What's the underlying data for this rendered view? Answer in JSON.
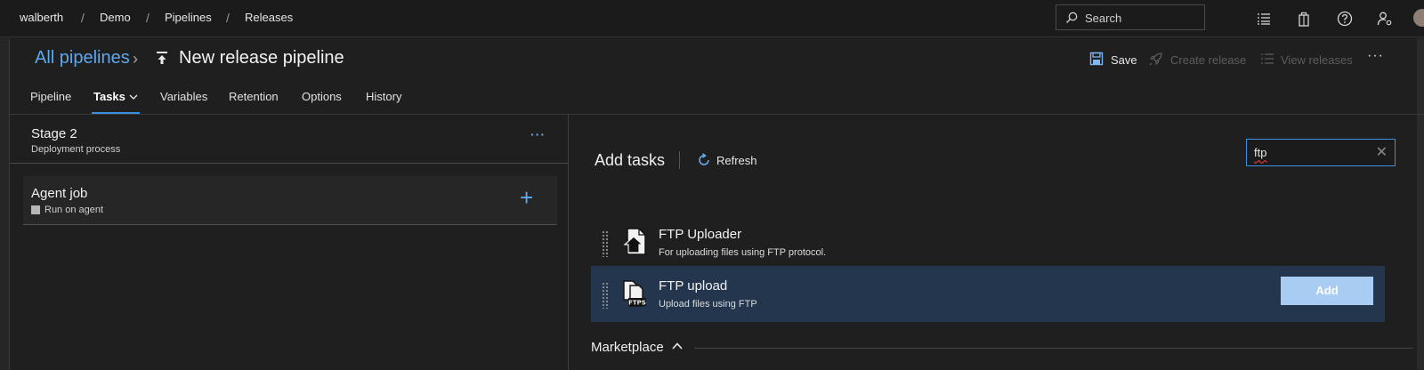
{
  "breadcrumb": {
    "items": [
      "walberth",
      "Demo",
      "Pipelines",
      "Releases"
    ],
    "separator": "/"
  },
  "search": {
    "placeholder": "Search"
  },
  "header": {
    "back_link": "All pipelines",
    "title": "New release pipeline",
    "actions": {
      "save": "Save",
      "create_release": "Create release",
      "view_releases": "View releases",
      "more": "···"
    }
  },
  "tabs": [
    {
      "label": "Pipeline",
      "active": false
    },
    {
      "label": "Tasks",
      "active": true
    },
    {
      "label": "Variables",
      "active": false
    },
    {
      "label": "Retention",
      "active": false
    },
    {
      "label": "Options",
      "active": false
    },
    {
      "label": "History",
      "active": false
    }
  ],
  "stage": {
    "title": "Stage 2",
    "subtitle": "Deployment process",
    "more": "···"
  },
  "agent_job": {
    "title": "Agent job",
    "subtitle": "Run on agent",
    "add": "+"
  },
  "add_tasks": {
    "title": "Add tasks",
    "refresh": "Refresh",
    "filter_value": "ftp",
    "clear": "✕",
    "tasks": [
      {
        "name": "FTP Uploader",
        "description": "For uploading files using FTP protocol.",
        "icon": "ftp-uploader-icon",
        "selected": false
      },
      {
        "name": "FTP upload",
        "description": "Upload files using FTP",
        "icon": "ftps-icon",
        "icon_label": "FTPS",
        "selected": true
      }
    ],
    "add_button": "Add",
    "marketplace": "Marketplace"
  },
  "colors": {
    "accent": "#3d8fe0",
    "link": "#5fa8ee",
    "selected_row": "#23364d",
    "add_button": "#a9cdf2"
  }
}
